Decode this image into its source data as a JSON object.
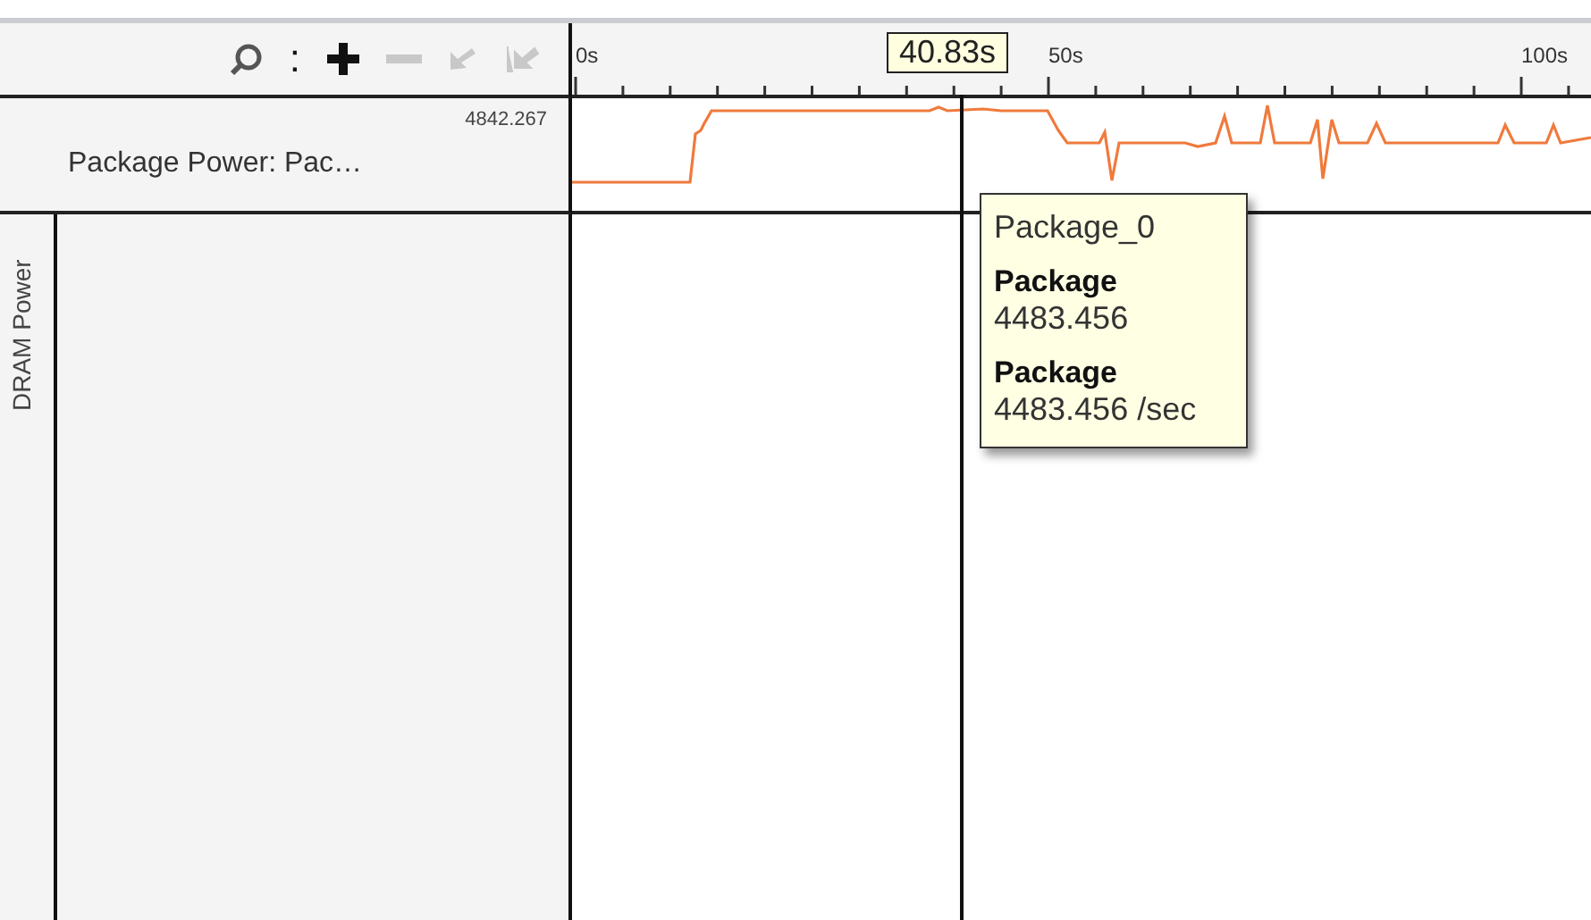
{
  "toolbar": {
    "items": [
      {
        "kind": "search",
        "disabled": false
      },
      {
        "kind": "more",
        "label": ":",
        "disabled": false
      },
      {
        "kind": "zoom-in",
        "disabled": false
      },
      {
        "kind": "zoom-out",
        "disabled": true
      },
      {
        "kind": "back",
        "disabled": true
      },
      {
        "kind": "reset",
        "disabled": true
      }
    ]
  },
  "ruler": {
    "ticks": [
      "0s",
      "50s",
      "100s"
    ],
    "cursor": "40.83s"
  },
  "tracks": [
    {
      "name": "Package Power: Pac…",
      "max": "4842.267"
    }
  ],
  "group": {
    "label": "DRAM Power"
  },
  "tooltip": {
    "title": "Package_0",
    "entries": [
      {
        "label": "Package",
        "value": "4483.456"
      },
      {
        "label": "Package",
        "value": "4483.456 /sec"
      }
    ]
  }
}
